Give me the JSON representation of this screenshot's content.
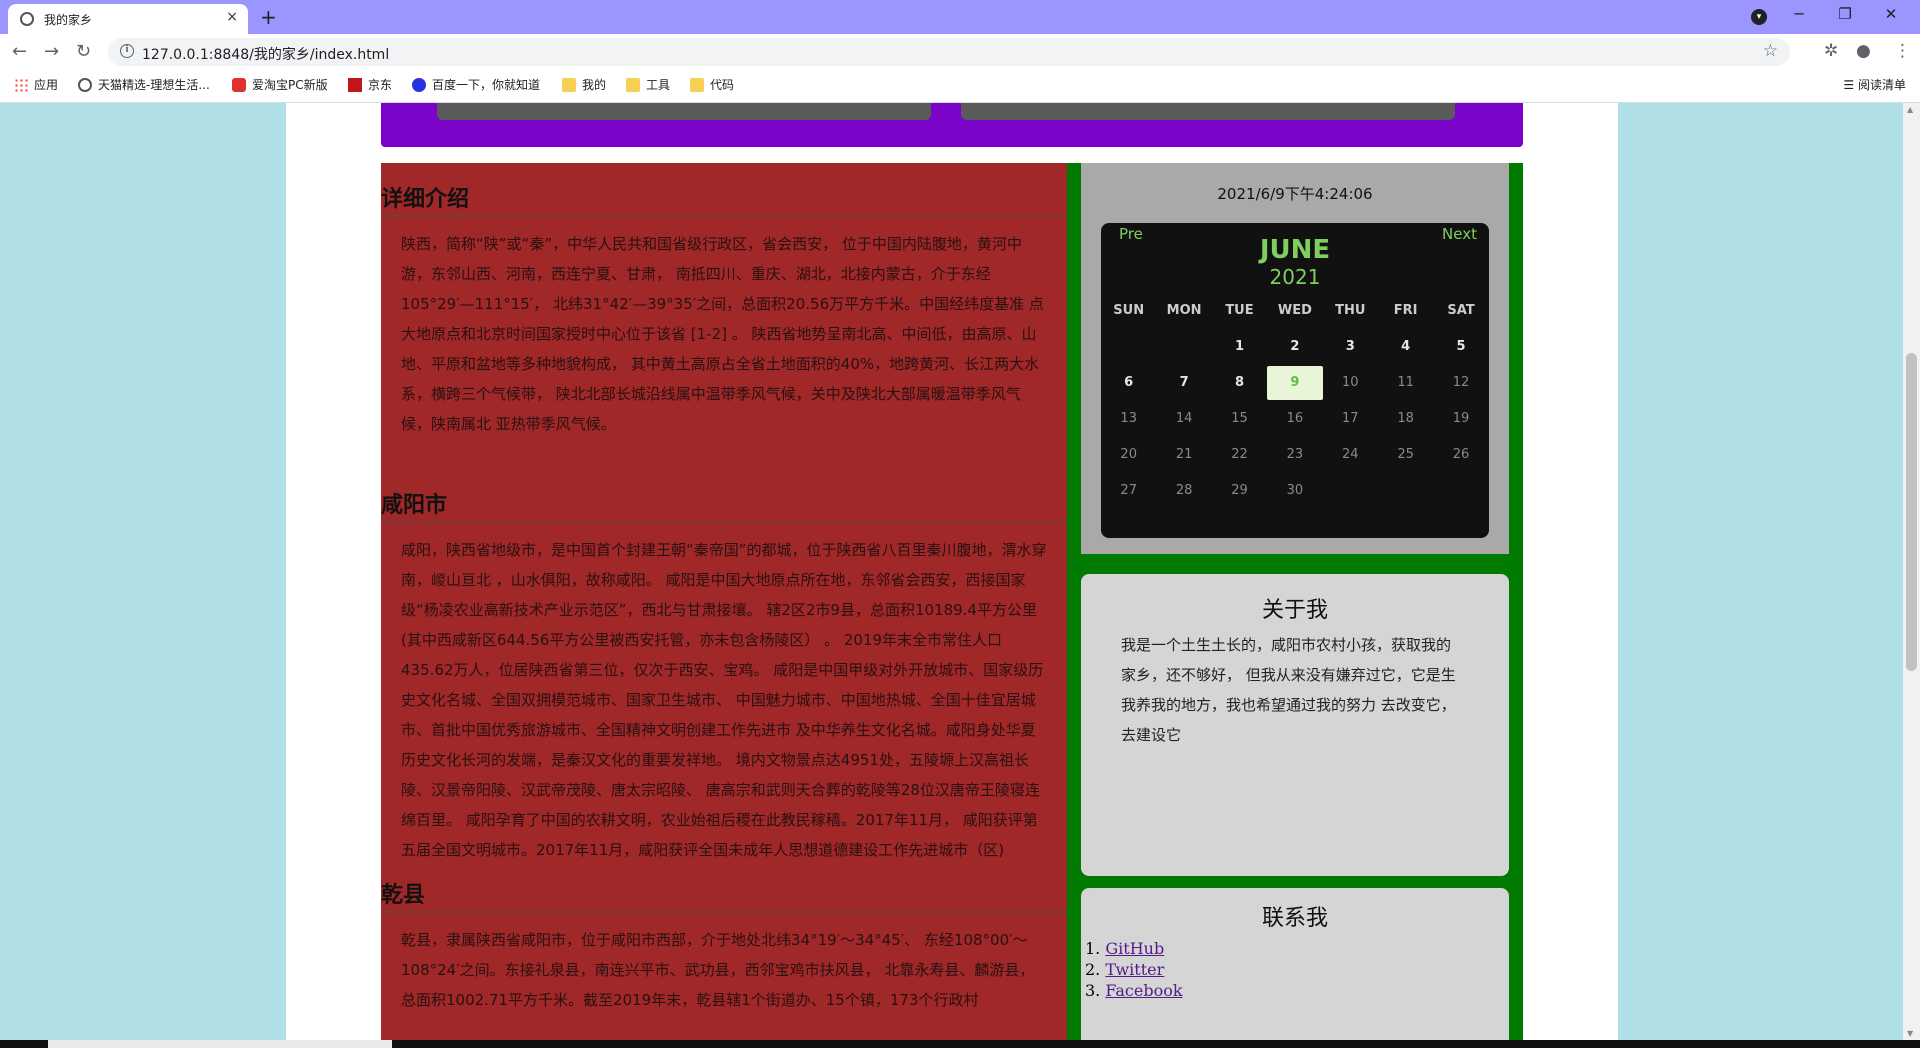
{
  "browser": {
    "tab_title": "我的家乡",
    "tab_close": "×",
    "new_tab": "+",
    "url": "127.0.0.1:8848/我的家乡/index.html",
    "back": "←",
    "forward": "→",
    "reload": "↻",
    "star": "☆",
    "extensions": "✲",
    "account": "●",
    "menu": "⋮",
    "minimize": "─",
    "restore": "❐",
    "close": "✕",
    "profile_menu": "▾"
  },
  "bookmarks": {
    "items": [
      {
        "label": "应用",
        "icon": "apps-grid-icon"
      },
      {
        "label": "天猫精选-理想生活...",
        "icon": "globe-icon"
      },
      {
        "label": "爱淘宝PC新版",
        "icon": "taobao-icon"
      },
      {
        "label": "京东",
        "icon": "jd-icon"
      },
      {
        "label": "百度一下，你就知道",
        "icon": "baidu-icon"
      },
      {
        "label": "我的",
        "icon": "folder-icon"
      },
      {
        "label": "工具",
        "icon": "folder-icon"
      },
      {
        "label": "代码",
        "icon": "folder-icon"
      }
    ],
    "reading_list": "阅读清单"
  },
  "main": {
    "sections": [
      {
        "title": "详细介绍",
        "text": "陕西，简称“陕”或“秦”，中华人民共和国省级行政区，省会西安， 位于中国内陆腹地，黄河中游，东邻山西、河南，西连宁夏、甘肃， 南抵四川、重庆、湖北，北接内蒙古，介于东经105°29′—111°15′， 北纬31°42′—39°35′之间，总面积20.56万平方千米。中国经纬度基准 点大地原点和北京时间国家授时中心位于该省 [1-2] 。 陕西省地势呈南北高、中间低，由高原、山地、平原和盆地等多种地貌构成， 其中黄土高原占全省土地面积的40%，地跨黄河、长江两大水系，横跨三个气候带， 陕北北部长城沿线属中温带季风气候，关中及陕北大部属暖温带季风气候，陕南属北 亚热带季风气候。"
      },
      {
        "title": "咸阳市",
        "text": "咸阳，陕西省地级市，是中国首个封建王朝“秦帝国”的都城，位于陕西省八百里秦川腹地，渭水穿南，嵕山亘北 ，山水俱阳，故称咸阳。 咸阳是中国大地原点所在地，东邻省会西安，西接国家级“杨凌农业高新技术产业示范区”，西北与甘肃接壤。 辖2区2市9县，总面积10189.4平方公里(其中西咸新区644.56平方公里被西安托管，亦未包含杨陵区） 。 2019年末全市常住人口435.62万人，位居陕西省第三位，仅次于西安、宝鸡。 咸阳是中国甲级对外开放城市、国家级历史文化名城、全国双拥模范城市、国家卫生城市、 中国魅力城市、中国地热城、全国十佳宜居城市、首批中国优秀旅游城市、全国精神文明创建工作先进市 及中华养生文化名城。咸阳身处华夏历史文化长河的发端，是秦汉文化的重要发祥地。 境内文物景点达4951处，五陵塬上汉高祖长陵、汉景帝阳陵、汉武帝茂陵、唐太宗昭陵、 唐高宗和武则天合葬的乾陵等28位汉唐帝王陵寝连绵百里。 咸阳孕育了中国的农耕文明，农业始祖后稷在此教民稼穑。2017年11月， 咸阳获评第五届全国文明城市。2017年11月，咸阳获评全国未成年人思想道德建设工作先进城市（区)"
      },
      {
        "title": "乾县",
        "text": "乾县，隶属陕西省咸阳市，位于咸阳市西部，介于地处北纬34°19′～34°45′、 东经108°00′～108°24′之间。东接礼泉县，南连兴平市、武功县，西邻宝鸡市扶风县， 北靠永寿县、麟游县，总面积1002.71平方千米。截至2019年末，乾县辖1个街道办、15个镇，173个行政村"
      }
    ]
  },
  "sidebar": {
    "clock": "2021/6/9下午4:24:06",
    "calendar": {
      "pre": "Pre",
      "next": "Next",
      "month": "JUNE",
      "year": "2021",
      "weekdays": [
        "SUN",
        "MON",
        "TUE",
        "WED",
        "THU",
        "FRI",
        "SAT"
      ],
      "weeks": [
        [
          "",
          "",
          "1",
          "2",
          "3",
          "4",
          "5"
        ],
        [
          "6",
          "7",
          "8",
          "9",
          "10",
          "11",
          "12"
        ],
        [
          "13",
          "14",
          "15",
          "16",
          "17",
          "18",
          "19"
        ],
        [
          "20",
          "21",
          "22",
          "23",
          "24",
          "25",
          "26"
        ],
        [
          "27",
          "28",
          "29",
          "30",
          "",
          "",
          ""
        ]
      ],
      "today": "9"
    },
    "about": {
      "title": "关于我",
      "text": "我是一个土生土长的，咸阳市农村小孩，获取我的家乡，还不够好， 但我从来没有嫌弃过它，它是生我养我的地方，我也希望通过我的努力 去改变它，去建设它"
    },
    "contact": {
      "title": "联系我",
      "links": [
        {
          "num": "1.",
          "label": "GitHub"
        },
        {
          "num": "2.",
          "label": "Twitter"
        },
        {
          "num": "3.",
          "label": "Facebook"
        }
      ]
    }
  },
  "colors": {
    "page_bg": "#b0e0e6",
    "header": "#7a05c9",
    "main_bg": "#a02828",
    "sidebar_bg": "#007a00",
    "calendar_accent": "#7fcf5f"
  }
}
